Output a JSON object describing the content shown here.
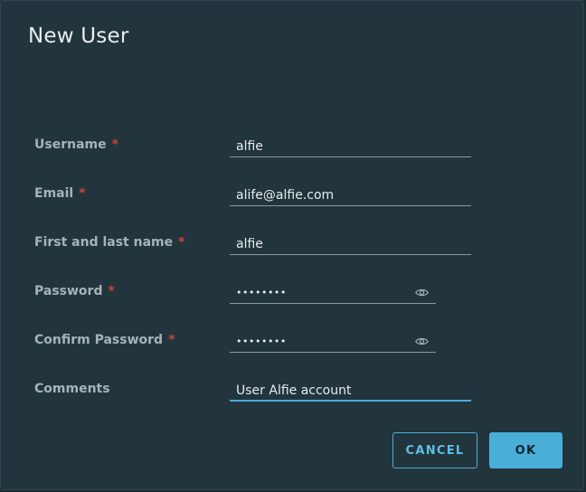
{
  "dialog": {
    "title": "New User"
  },
  "form": {
    "username": {
      "label": "Username",
      "required": "*",
      "value": "alfie"
    },
    "email": {
      "label": "Email",
      "required": "*",
      "value": "alife@alfie.com"
    },
    "name": {
      "label": "First and last name",
      "required": "*",
      "value": "alfie"
    },
    "password": {
      "label": "Password",
      "required": "*",
      "masked": "••••••••",
      "icon": "eye-icon"
    },
    "confirm_password": {
      "label": "Confirm Password",
      "required": "*",
      "masked": "••••••••",
      "icon": "eye-icon"
    },
    "comments": {
      "label": "Comments",
      "value": "User Alfie account"
    }
  },
  "actions": {
    "cancel_label": "CANCEL",
    "ok_label": "OK"
  },
  "colors": {
    "background": "#22343c",
    "accent": "#49afd9",
    "required": "#c8453a",
    "label": "#a6b3ba"
  }
}
